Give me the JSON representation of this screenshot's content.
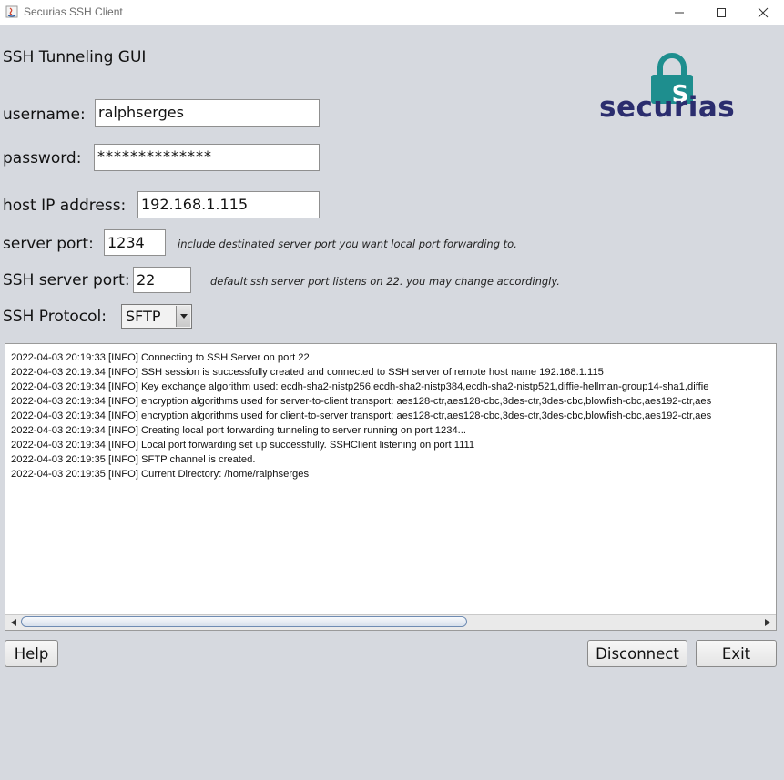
{
  "window": {
    "title": "Securias SSH Client"
  },
  "header": {
    "heading": "SSH Tunneling GUI",
    "logo_text": "securias",
    "logo_badge": "S"
  },
  "form": {
    "username_label": "username:",
    "username_value": "ralphserges",
    "password_label": "password:",
    "password_value": "**************",
    "host_label": "host IP address:",
    "host_value": "192.168.1.115",
    "server_port_label": "server port:",
    "server_port_value": "1234",
    "server_port_hint": "include destinated server port you want local port forwarding to.",
    "ssh_port_label": "SSH server port:",
    "ssh_port_value": "22",
    "ssh_port_hint": "default ssh server port listens on 22. you may change accordingly.",
    "protocol_label": "SSH Protocol:",
    "protocol_value": "SFTP"
  },
  "log": {
    "lines": [
      "2022-04-03 20:19:33 [INFO] Connecting to SSH Server on port 22",
      "2022-04-03 20:19:34 [INFO] SSH session is successfully created and connected to SSH server of remote host name 192.168.1.115",
      "2022-04-03 20:19:34 [INFO] Key exchange algorithm used: ecdh-sha2-nistp256,ecdh-sha2-nistp384,ecdh-sha2-nistp521,diffie-hellman-group14-sha1,diffie",
      "2022-04-03 20:19:34 [INFO] encryption algorithms used for server-to-client transport: aes128-ctr,aes128-cbc,3des-ctr,3des-cbc,blowfish-cbc,aes192-ctr,aes",
      "2022-04-03 20:19:34 [INFO] encryption algorithms used for client-to-server transport: aes128-ctr,aes128-cbc,3des-ctr,3des-cbc,blowfish-cbc,aes192-ctr,aes",
      "2022-04-03 20:19:34 [INFO] Creating local port forwarding tunneling to server running on port 1234...",
      "2022-04-03 20:19:34 [INFO] Local port forwarding set up successfully. SSHClient listening on port 1111",
      "2022-04-03 20:19:35 [INFO] SFTP channel is created.",
      "2022-04-03 20:19:35 [INFO] Current Directory: /home/ralphserges"
    ]
  },
  "buttons": {
    "help": "Help",
    "disconnect": "Disconnect",
    "exit": "Exit"
  },
  "colors": {
    "background": "#d6d9df",
    "logo_teal": "#1e8e8e",
    "logo_navy": "#2b2d6e"
  }
}
